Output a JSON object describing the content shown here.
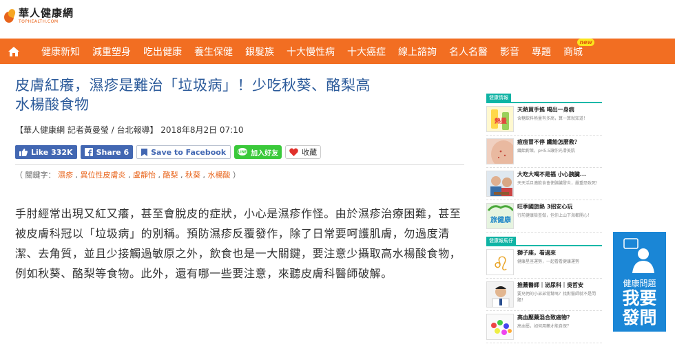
{
  "site": {
    "name": "華人健康網",
    "sub": "TOPHEALTH.COM"
  },
  "nav": {
    "home_icon": "home-icon",
    "items": [
      "健康新知",
      "減重塑身",
      "吃出健康",
      "養生保健",
      "銀髮族",
      "十大慢性病",
      "十大癌症",
      "線上諮詢",
      "名人名醫",
      "影音",
      "專題",
      "商城"
    ],
    "new_badge": "new"
  },
  "article": {
    "title_line1": "皮膚紅癢，濕疹是難治「垃圾病」！少吃秋葵、酪梨高",
    "title_line2": "水楊酸食物",
    "byline": "【華人健康網 記者黃曼瑩 / 台北報導】 2018年8月2日 07:10",
    "like_label": "Like 332K",
    "share_label": "Share 6",
    "save_label": "Save to Facebook",
    "line_label": "加入好友",
    "fav_label": "收藏",
    "keywords_prefix": "（ 關鍵字：",
    "keywords": [
      "濕疹",
      "異位性皮膚炎",
      "盧靜怡",
      "酪梨",
      "秋葵",
      "水楊酸"
    ],
    "keywords_suffix": "）",
    "body": "手肘經常出現又紅又癢，甚至會脫皮的症狀，小心是濕疹作怪。由於濕疹治療困難，甚至被皮膚科冠以「垃圾病」的別稱。預防濕疹反覆發作，除了日常要呵護肌膚，勿過度清潔、去角質，並且少接觸過敏原之外，飲食也是一大關鍵，要注意少攝取高水楊酸食物，例如秋葵、酪梨等食物。此外，還有哪一些要注意，來聽皮膚科醫師破解。"
  },
  "sidebar": {
    "section1_label": "健康情報",
    "section1": [
      {
        "title": "天熱買手搖 喝出一身病",
        "desc": "含糖飲料熱量有多高，算一算就知道！",
        "thumb_text": "熱量有幾"
      },
      {
        "title": "痘痘冒不停 纖飴怎麼救？",
        "desc": "纖飴對策，pH5.5讓你光滑美肌",
        "thumb_text": ""
      },
      {
        "title": "大吃大喝不是福 小心胰臟...",
        "desc": "天天活且適飲食會使胰臟發炎，嚴重恐致死！",
        "thumb_text": ""
      },
      {
        "title": "旺季國旅熱 3招安心玩",
        "desc": "行前健康檢查做，包你上山下海都開心！",
        "thumb_text": "旅健康"
      }
    ],
    "section2_label": "健康報馬仔",
    "section2": [
      {
        "title": "獅子座，看過來",
        "desc": "健康星座運勢，一起看看健康運勢",
        "thumb_text": "♌"
      },
      {
        "title": "推薦醫師｜泌尿科｜吳哲安",
        "desc": "要兒們的小弟弟常幫嗎？找對醫師就不是問題！",
        "thumb_text": ""
      },
      {
        "title": "高血壓藥混合致癌物？",
        "desc": "高血壓，如何用藥才能自保？",
        "thumb_text": ""
      }
    ]
  },
  "ask": {
    "label": "健康問題",
    "big1": "我要",
    "big2": "發問"
  },
  "colors": {
    "nav_bg": "#f26e22",
    "title": "#2b5a9a",
    "fb": "#4267b2",
    "line": "#3ac93a",
    "ask_bg": "#1a86d6",
    "keyword": "#e8641b"
  }
}
